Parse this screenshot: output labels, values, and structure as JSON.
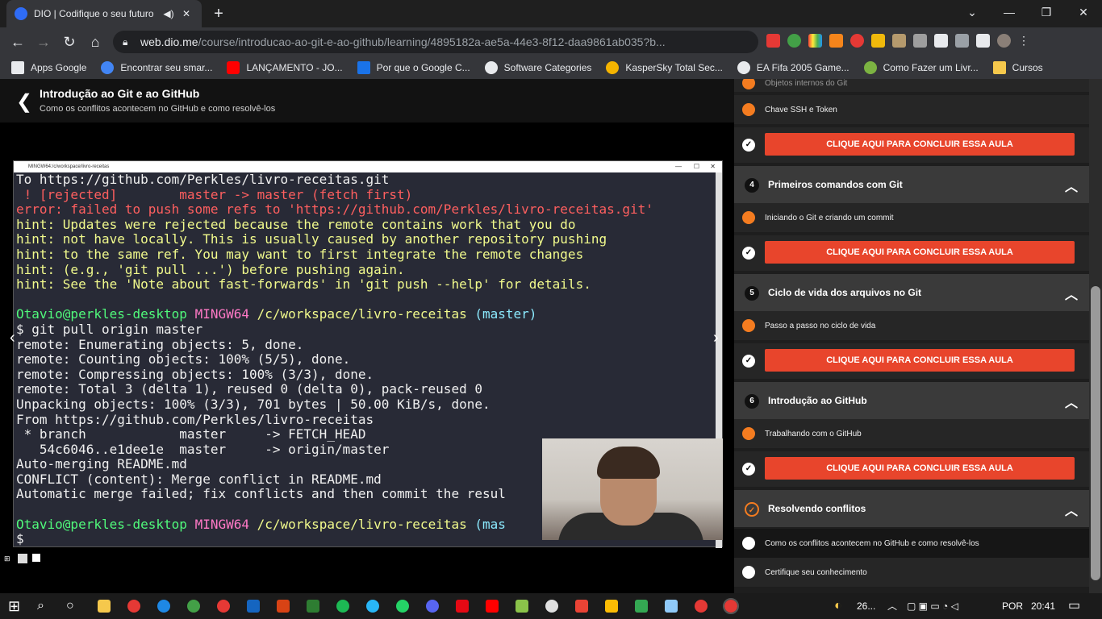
{
  "browser": {
    "tab_title": "DIO | Codifique o seu futuro",
    "url_host": "web.dio.me",
    "url_path": "/course/introducao-ao-git-e-ao-github/learning/4895182a-ae5a-44e3-8f12-daa9861ab035?b...",
    "bookmarks": [
      {
        "label": "Apps Google",
        "color": "#e8eaed"
      },
      {
        "label": "Encontrar seu smar...",
        "color": "#4285f4"
      },
      {
        "label": "LANÇAMENTO - JO...",
        "color": "#ff0000"
      },
      {
        "label": "Por que o Google C...",
        "color": "#1a73e8"
      },
      {
        "label": "Software Categories",
        "color": "#e8eaed"
      },
      {
        "label": "KasperSky Total Sec...",
        "color": "#f5b400"
      },
      {
        "label": "EA Fifa 2005 Game...",
        "color": "#e8eaed"
      },
      {
        "label": "Como Fazer um Livr...",
        "color": "#7cb342"
      },
      {
        "label": "Cursos",
        "color": "#f5c84c"
      }
    ]
  },
  "course": {
    "title": "Introdução ao Git e ao GitHub",
    "subtitle": "Como os conflitos acontecem no GitHub e como resolvê-los"
  },
  "terminal": {
    "window_title": "MINGW64:/c/workspace/livro-receitas",
    "lines": [
      {
        "t": "To https://github.com/Perkles/livro-receitas.git",
        "c": ""
      },
      {
        "t": " ! [rejected]        master -> master (fetch first)",
        "c": "red"
      },
      {
        "t": "error: failed to push some refs to 'https://github.com/Perkles/livro-receitas.git'",
        "c": "red"
      },
      {
        "t": "hint: Updates were rejected because the remote contains work that you do",
        "c": "yel"
      },
      {
        "t": "hint: not have locally. This is usually caused by another repository pushing",
        "c": "yel"
      },
      {
        "t": "hint: to the same ref. You may want to first integrate the remote changes",
        "c": "yel"
      },
      {
        "t": "hint: (e.g., 'git pull ...') before pushing again.",
        "c": "yel"
      },
      {
        "t": "hint: See the 'Note about fast-forwards' in 'git push --help' for details.",
        "c": "yel"
      },
      {
        "t": "",
        "c": ""
      },
      {
        "t": "prompt1",
        "c": "prompt"
      },
      {
        "t": "$ git pull origin master",
        "c": ""
      },
      {
        "t": "remote: Enumerating objects: 5, done.",
        "c": ""
      },
      {
        "t": "remote: Counting objects: 100% (5/5), done.",
        "c": ""
      },
      {
        "t": "remote: Compressing objects: 100% (3/3), done.",
        "c": ""
      },
      {
        "t": "remote: Total 3 (delta 1), reused 0 (delta 0), pack-reused 0",
        "c": ""
      },
      {
        "t": "Unpacking objects: 100% (3/3), 701 bytes | 50.00 KiB/s, done.",
        "c": ""
      },
      {
        "t": "From https://github.com/Perkles/livro-receitas",
        "c": ""
      },
      {
        "t": " * branch            master     -> FETCH_HEAD",
        "c": ""
      },
      {
        "t": "   54c6046..e1dee1e  master     -> origin/master",
        "c": ""
      },
      {
        "t": "Auto-merging README.md",
        "c": ""
      },
      {
        "t": "CONFLICT (content): Merge conflict in README.md",
        "c": ""
      },
      {
        "t": "Automatic merge failed; fix conflicts and then commit the resul",
        "c": ""
      },
      {
        "t": "",
        "c": ""
      },
      {
        "t": "prompt2",
        "c": "prompt"
      },
      {
        "t": "$",
        "c": ""
      }
    ],
    "prompt": {
      "user": "Otavio@perkles-desktop",
      "sys": "MINGW64",
      "path": "/c/workspace/livro-receitas",
      "branch": "(master)",
      "branch_cut": "(mas"
    }
  },
  "sidebar": {
    "top_partial": "Objetos internos do Git",
    "lessons_top": [
      {
        "label": "Chave SSH e Token"
      }
    ],
    "cta_label": "CLIQUE AQUI PARA CONCLUIR ESSA AULA",
    "modules": [
      {
        "num": "4",
        "title": "Primeiros comandos com Git",
        "lesson": "Iniciando o Git e criando um commit"
      },
      {
        "num": "5",
        "title": "Ciclo de vida dos arquivos no Git",
        "lesson": "Passo a passo no ciclo de vida"
      },
      {
        "num": "6",
        "title": "Introdução ao GitHub",
        "lesson": "Trabalhando com o GitHub"
      }
    ],
    "current_module": {
      "title": "Resolvendo conflitos",
      "lessons": [
        "Como os conflitos acontecem no GitHub e como resolvê-los",
        "Certifique seu conhecimento"
      ]
    }
  },
  "taskbar": {
    "weather": "26...",
    "lang": "POR",
    "time": "20:41"
  }
}
